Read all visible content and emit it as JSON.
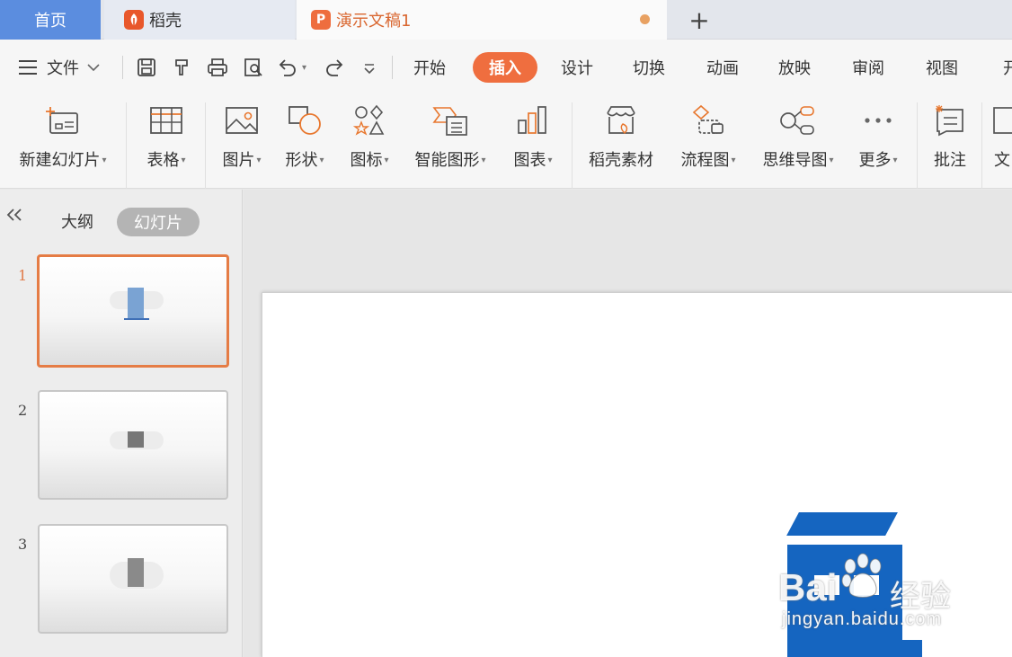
{
  "tabs": {
    "home": "首页",
    "daoke": "稻壳",
    "doc": "演示文稿1",
    "add": "+"
  },
  "menu": {
    "file": "文件",
    "items": [
      "开始",
      "插入",
      "设计",
      "切换",
      "动画",
      "放映",
      "审阅",
      "视图"
    ],
    "overflow": "开",
    "active": "插入"
  },
  "ribbon": {
    "new_slide": "新建幻灯片",
    "table": "表格",
    "picture": "图片",
    "shape": "形状",
    "icon": "图标",
    "smartart": "智能图形",
    "chart": "图表",
    "daoke_material": "稻壳素材",
    "flowchart": "流程图",
    "mindmap": "思维导图",
    "more": "更多",
    "comment": "批注",
    "text": "文"
  },
  "left_panel": {
    "outline": "大纲",
    "slides": "幻灯片",
    "slide_numbers": [
      "1",
      "2",
      "3"
    ]
  },
  "watermark": {
    "logo": "Bai",
    "text": "经验",
    "url": "jingyan.baidu.com"
  },
  "colors": {
    "accent": "#ef6e3f",
    "home_tab": "#5b8ddf",
    "slide_char": "#1565c0"
  }
}
